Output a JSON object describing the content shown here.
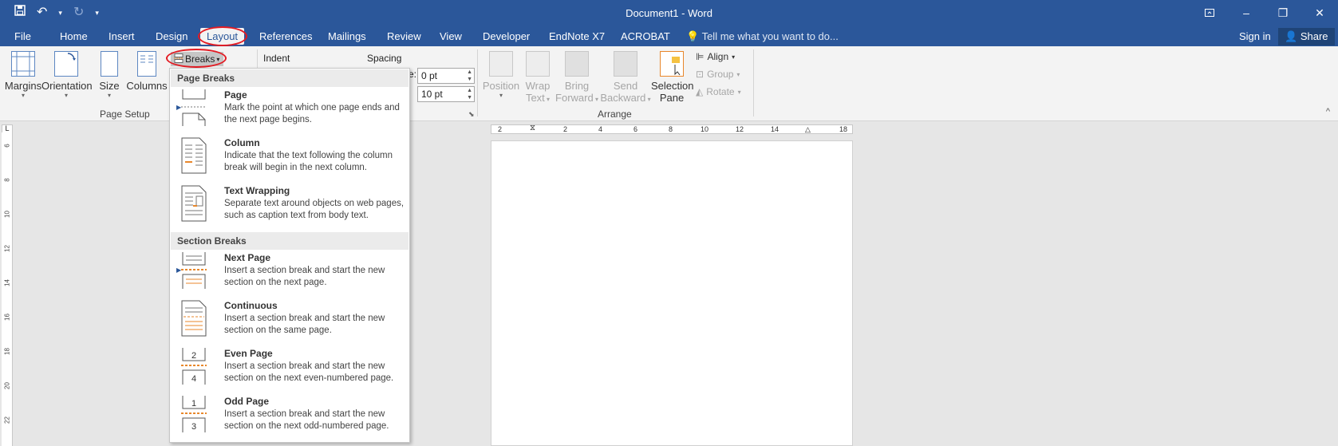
{
  "window": {
    "title": "Document1 - Word",
    "qat": {
      "save_icon": "save-icon",
      "undo_icon": "undo-icon",
      "redo_icon": "redo-icon",
      "customize_icon": "customize-qat-icon"
    },
    "controls": {
      "restore_ribbon_icon": "ribbon-display-icon",
      "minimize": "–",
      "maximize": "❐",
      "close": "✕"
    }
  },
  "tabs": [
    "File",
    "Home",
    "Insert",
    "Design",
    "Layout",
    "References",
    "Mailings",
    "Review",
    "View",
    "Developer",
    "EndNote X7",
    "ACROBAT"
  ],
  "active_tab": "Layout",
  "tell_me": "Tell me what you want to do...",
  "signin": "Sign in",
  "share": "Share",
  "ribbon": {
    "page_setup": {
      "label": "Page Setup",
      "margins": "Margins",
      "orientation": "Orientation",
      "size": "Size",
      "columns": "Columns",
      "breaks": "Breaks"
    },
    "paragraph": {
      "indent": "Indent",
      "spacing": "Spacing",
      "spacing_before": "0 pt",
      "spacing_after": "10 pt",
      "before_label_fragment": "e:"
    },
    "arrange": {
      "label": "Arrange",
      "position": [
        "Position"
      ],
      "wrap_text": [
        "Wrap",
        "Text"
      ],
      "bring_forward": [
        "Bring",
        "Forward"
      ],
      "send_backward": [
        "Send",
        "Backward"
      ],
      "selection_pane": [
        "Selection",
        "Pane"
      ],
      "align": "Align",
      "group": "Group",
      "rotate": "Rotate"
    }
  },
  "rulers": {
    "horizontal": [
      "2",
      "2",
      "4",
      "6",
      "8",
      "10",
      "12",
      "14",
      "18"
    ],
    "vertical": [
      "6",
      "8",
      "10",
      "12",
      "14",
      "16",
      "18",
      "20",
      "22"
    ],
    "tab_selector": "L"
  },
  "breaks_menu": {
    "page_breaks_header": "Page Breaks",
    "section_breaks_header": "Section Breaks",
    "page_items": [
      {
        "name": "Page",
        "desc": "Mark the point at which one page ends and the next page begins."
      },
      {
        "name": "Column",
        "desc": "Indicate that the text following the column break will begin in the next column."
      },
      {
        "name": "Text Wrapping",
        "desc": "Separate text around objects on web pages, such as caption text from body text."
      }
    ],
    "section_items": [
      {
        "name": "Next Page",
        "desc": "Insert a section break and start the new section on the next page."
      },
      {
        "name": "Continuous",
        "desc": "Insert a section break and start the new section on the same page."
      },
      {
        "name": "Even Page",
        "desc": "Insert a section break and start the new section on the next even-numbered page."
      },
      {
        "name": "Odd Page",
        "desc": "Insert a section break and start the new section on the next odd-numbered page."
      }
    ],
    "even_digits": [
      "2",
      "4"
    ],
    "odd_digits": [
      "1",
      "3"
    ]
  },
  "colors": {
    "brand": "#2b579a",
    "highlight": "#e31b23",
    "accent_orange": "#e8872b"
  }
}
